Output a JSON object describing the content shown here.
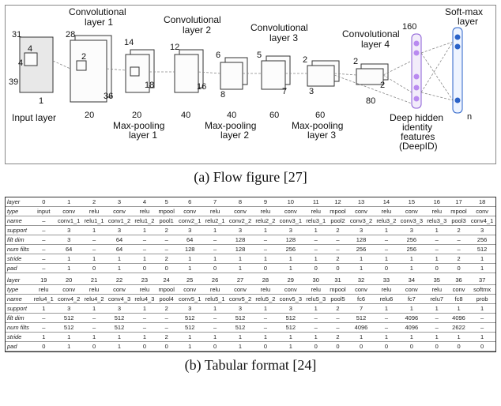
{
  "captions": {
    "a": "(a) Flow figure [27]",
    "b": "(b) Tabular format [24]"
  },
  "diagram": {
    "input_label": "Input layer",
    "conv1": "Convolutional\nlayer 1",
    "pool1": "Max-pooling\nlayer 1",
    "conv2": "Convolutional\nlayer 2",
    "pool2": "Max-pooling\nlayer 2",
    "conv3": "Convolutional\nlayer 3",
    "pool3": "Max-pooling\nlayer 3",
    "conv4": "Convolutional\nlayer 4",
    "deepid": "Deep hidden\nidentity\nfeatures\n(DeepID)",
    "softmax": "Soft-max\nlayer",
    "n": "n",
    "dims": {
      "in_h": "31",
      "in_w": "39",
      "in_d": "1",
      "in_kh": "4",
      "in_kw": "4",
      "c1_h": "28",
      "c1_w": "36",
      "c1_d": "20",
      "p1_h": "14",
      "p1_w": "18",
      "p1_d": "20",
      "c2_h": "12",
      "c2_w": "16",
      "c2_d": "40",
      "p2_h": "6",
      "p2_w": "8",
      "p2_d": "40",
      "c3_h": "5",
      "c3_w": "7",
      "c3_d": "60",
      "p3_h": "2",
      "p3_w": "3",
      "p3_d": "60",
      "c4_h": "2",
      "c4_w": "2",
      "c4_d": "80",
      "fc": "160",
      "k_conv": "2",
      "k_pool": "2",
      "k_small": "1",
      "k3": "3"
    }
  },
  "table": {
    "row_labels": [
      "layer",
      "type",
      "name",
      "support",
      "filt dim",
      "num filts",
      "stride",
      "pad"
    ],
    "top": {
      "layer": [
        "0",
        "1",
        "2",
        "3",
        "4",
        "5",
        "6",
        "7",
        "8",
        "9",
        "10",
        "11",
        "12",
        "13",
        "14",
        "15",
        "16",
        "17",
        "18"
      ],
      "type": [
        "input",
        "conv",
        "relu",
        "conv",
        "relu",
        "mpool",
        "conv",
        "relu",
        "conv",
        "relu",
        "conv",
        "relu",
        "mpool",
        "conv",
        "relu",
        "conv",
        "relu",
        "mpool",
        "conv"
      ],
      "name": [
        "–",
        "conv1_1",
        "relu1_1",
        "conv1_2",
        "relu1_2",
        "pool1",
        "conv2_1",
        "relu2_1",
        "conv2_2",
        "relu2_2",
        "conv3_1",
        "relu3_1",
        "pool2",
        "conv3_2",
        "relu3_2",
        "conv3_3",
        "relu3_3",
        "pool3",
        "conv4_1"
      ],
      "support": [
        "–",
        "3",
        "1",
        "3",
        "1",
        "2",
        "3",
        "1",
        "3",
        "1",
        "3",
        "1",
        "2",
        "3",
        "1",
        "3",
        "1",
        "2",
        "3"
      ],
      "filtdim": [
        "–",
        "3",
        "–",
        "64",
        "–",
        "–",
        "64",
        "–",
        "128",
        "–",
        "128",
        "–",
        "–",
        "128",
        "–",
        "256",
        "–",
        "–",
        "256"
      ],
      "numfilts": [
        "–",
        "64",
        "–",
        "64",
        "–",
        "–",
        "128",
        "–",
        "128",
        "–",
        "256",
        "–",
        "–",
        "256",
        "–",
        "256",
        "–",
        "–",
        "512"
      ],
      "stride": [
        "–",
        "1",
        "1",
        "1",
        "1",
        "2",
        "1",
        "1",
        "1",
        "1",
        "1",
        "1",
        "2",
        "1",
        "1",
        "1",
        "1",
        "2",
        "1"
      ],
      "pad": [
        "–",
        "1",
        "0",
        "1",
        "0",
        "0",
        "1",
        "0",
        "1",
        "0",
        "1",
        "0",
        "0",
        "1",
        "0",
        "1",
        "0",
        "0",
        "1"
      ]
    },
    "bottom": {
      "layer": [
        "19",
        "20",
        "21",
        "22",
        "23",
        "24",
        "25",
        "26",
        "27",
        "28",
        "29",
        "30",
        "31",
        "32",
        "33",
        "34",
        "35",
        "36",
        "37"
      ],
      "type": [
        "relu",
        "conv",
        "relu",
        "conv",
        "relu",
        "mpool",
        "conv",
        "relu",
        "conv",
        "relu",
        "conv",
        "relu",
        "mpool",
        "conv",
        "relu",
        "conv",
        "relu",
        "conv",
        "softmx"
      ],
      "name": [
        "relu4_1",
        "conv4_2",
        "relu4_2",
        "conv4_3",
        "relu4_3",
        "pool4",
        "conv5_1",
        "relu5_1",
        "conv5_2",
        "relu5_2",
        "conv5_3",
        "relu5_3",
        "pool5",
        "fc6",
        "relu6",
        "fc7",
        "relu7",
        "fc8",
        "prob"
      ],
      "support": [
        "1",
        "3",
        "1",
        "3",
        "1",
        "2",
        "3",
        "1",
        "3",
        "1",
        "3",
        "1",
        "2",
        "7",
        "1",
        "1",
        "1",
        "1",
        "1"
      ],
      "filtdim": [
        "–",
        "512",
        "–",
        "512",
        "–",
        "–",
        "512",
        "–",
        "512",
        "–",
        "512",
        "–",
        "–",
        "512",
        "–",
        "4096",
        "–",
        "4096",
        "–"
      ],
      "numfilts": [
        "–",
        "512",
        "–",
        "512",
        "–",
        "–",
        "512",
        "–",
        "512",
        "–",
        "512",
        "–",
        "–",
        "4096",
        "–",
        "4096",
        "–",
        "2622",
        "–"
      ],
      "stride": [
        "1",
        "1",
        "1",
        "1",
        "1",
        "2",
        "1",
        "1",
        "1",
        "1",
        "1",
        "1",
        "2",
        "1",
        "1",
        "1",
        "1",
        "1",
        "1"
      ],
      "pad": [
        "0",
        "1",
        "0",
        "1",
        "0",
        "0",
        "1",
        "0",
        "1",
        "0",
        "1",
        "0",
        "0",
        "0",
        "0",
        "0",
        "0",
        "0",
        "0"
      ]
    }
  },
  "chart_data": {
    "type": "table",
    "title": "CNN architecture layer specification",
    "columns_top": [
      "0",
      "1",
      "2",
      "3",
      "4",
      "5",
      "6",
      "7",
      "8",
      "9",
      "10",
      "11",
      "12",
      "13",
      "14",
      "15",
      "16",
      "17",
      "18"
    ],
    "columns_bottom": [
      "19",
      "20",
      "21",
      "22",
      "23",
      "24",
      "25",
      "26",
      "27",
      "28",
      "29",
      "30",
      "31",
      "32",
      "33",
      "34",
      "35",
      "36",
      "37"
    ],
    "rows": [
      "type",
      "name",
      "support",
      "filt dim",
      "num filts",
      "stride",
      "pad"
    ]
  }
}
